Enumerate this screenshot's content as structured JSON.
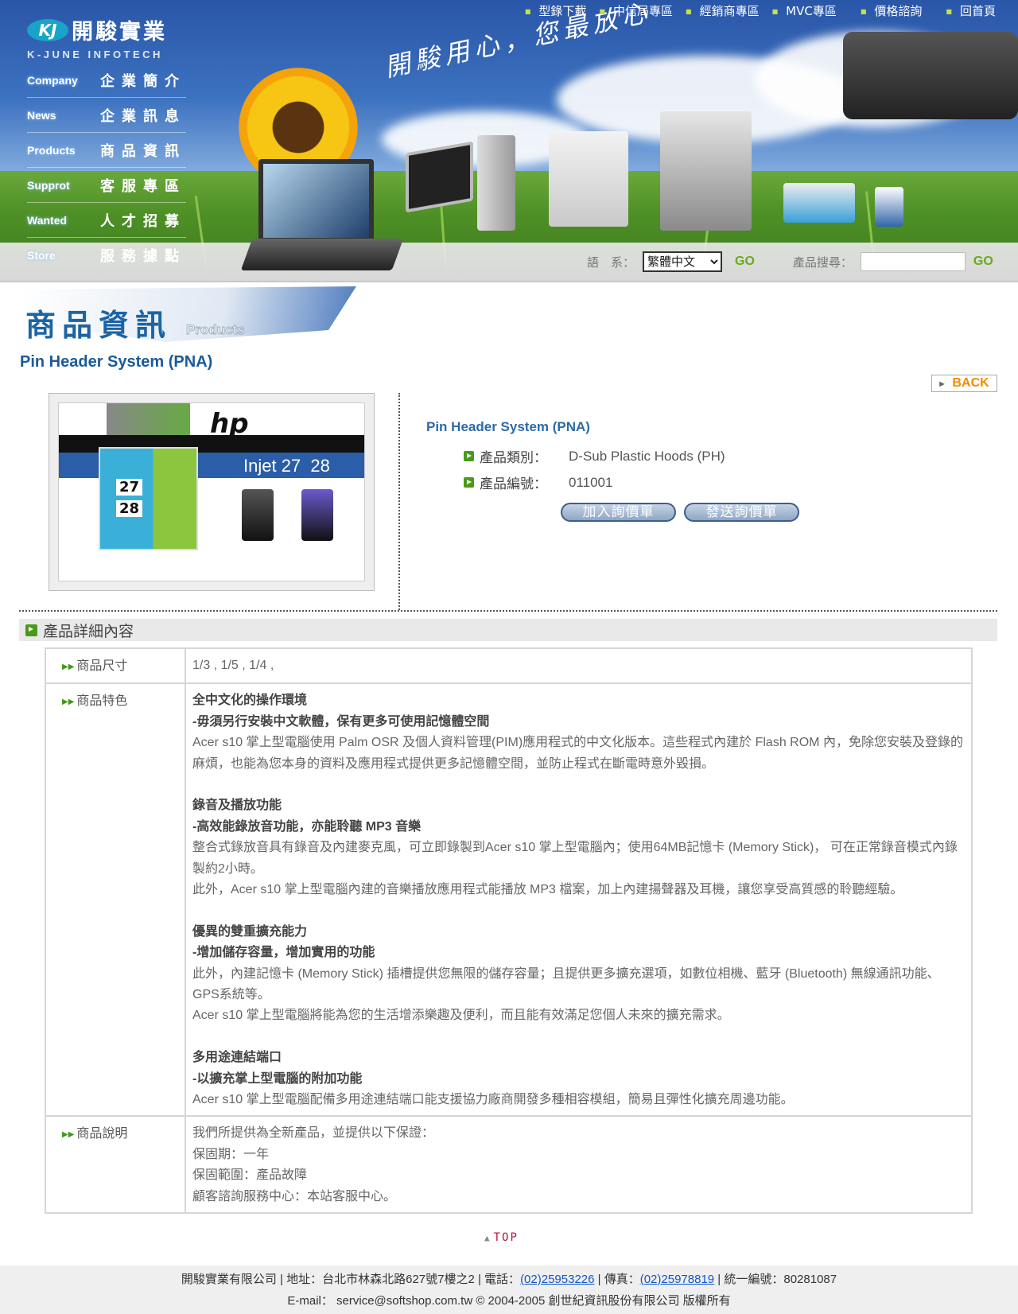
{
  "header": {
    "logo": {
      "mark": "KJ",
      "name_cn": "開駿實業",
      "name_en": "K-JUNE INFOTECH"
    },
    "slogan": "開駿用心，您最放心",
    "top_nav": [
      "型錄下載",
      "中信局專區",
      "經銷商專區",
      "MVC專區",
      "價格諮詢",
      "回首頁"
    ],
    "menu": [
      {
        "en": "Company",
        "cn": "企業簡介"
      },
      {
        "en": "News",
        "cn": "企業訊息"
      },
      {
        "en": "Products",
        "cn": "商品資訊"
      },
      {
        "en": "Supprot",
        "cn": "客服專區"
      },
      {
        "en": "Wanted",
        "cn": "人才招募"
      },
      {
        "en": "Store",
        "cn": "服務據點"
      }
    ],
    "language_label": "語　系：",
    "language_selected": "繁體中文",
    "go_label": "GO",
    "search_label": "產品搜尋：",
    "search_value": "",
    "search_go_label": "GO"
  },
  "section": {
    "title_cn": "商品資訊",
    "title_en": "Products"
  },
  "product": {
    "title": "Pin Header System (PNA)",
    "back_label": "BACK",
    "image_text": {
      "brand": "hp",
      "caption": "Injet 27  28",
      "n1": "27",
      "n2": "28"
    },
    "info_title": "Pin Header System (PNA)",
    "category_label": "產品類別：",
    "category_value": "D-Sub Plastic Hoods (PH)",
    "number_label": "產品編號：",
    "number_value": "011001",
    "add_inquiry_label": "加入詢價單",
    "send_inquiry_label": "發送詢價單"
  },
  "details": {
    "heading": "產品詳細內容",
    "size_label": "商品尺寸",
    "size_value": "1/3 , 1/5 , 1/4 ,",
    "features_label": "商品特色",
    "features": [
      {
        "title": "全中文化的操作環境",
        "subtitle": "-毋須另行安裝中文軟體，保有更多可使用記憶體空間",
        "paragraphs": [
          "Acer s10 掌上型電腦使用 Palm OSR 及個人資料管理(PIM)應用程式的中文化版本。這些程式內建於 Flash ROM 內，免除您安裝及登錄的麻煩，也能為您本身的資料及應用程式提供更多記憶體空間，並防止程式在斷電時意外毀損。"
        ]
      },
      {
        "title": "錄音及播放功能",
        "subtitle": "-高效能錄放音功能，亦能聆聽 MP3 音樂",
        "paragraphs": [
          "整合式錄放音具有錄音及內建麥克風，可立即錄製到Acer s10 掌上型電腦內；使用64MB記憶卡 (Memory Stick)， 可在正常錄音模式內錄製約2小時。",
          "此外，Acer s10 掌上型電腦內建的音樂播放應用程式能播放 MP3 檔案，加上內建揚聲器及耳機，讓您享受高質感的聆聽經驗。"
        ]
      },
      {
        "title": "優異的雙重擴充能力",
        "subtitle": "-增加儲存容量，增加實用的功能",
        "paragraphs": [
          "此外，內建記憶卡 (Memory Stick) 插槽提供您無限的儲存容量；且提供更多擴充選項，如數位相機、藍牙 (Bluetooth) 無線通訊功能、GPS系統等。",
          "Acer s10 掌上型電腦將能為您的生活增添樂趣及便利，而且能有效滿足您個人未來的擴充需求。"
        ]
      },
      {
        "title": "多用途連結端口",
        "subtitle": "-以擴充掌上型電腦的附加功能",
        "paragraphs": [
          "Acer s10 掌上型電腦配備多用途連結端口能支援協力廠商開發多種相容模組，簡易且彈性化擴充周邊功能。"
        ]
      }
    ],
    "description_label": "商品說明",
    "description_lines": [
      "我們所提供為全新產品，並提供以下保證：",
      "保固期：一年",
      "保固範圍：產品故障",
      "顧客諮詢服務中心：本站客服中心。"
    ]
  },
  "top_label": "TOP",
  "footer": {
    "company": "開駿實業有限公司 | 地址：台北市林森北路627號7樓之2 | 電話：",
    "phone": "(02)25953226",
    "fax_label": " | 傳真：",
    "fax": "(02)25978819",
    "tax_id": " | 統一編號：80281087",
    "email_line": "E-mail： service@softshop.com.tw © 2004-2005 創世紀資訊股份有限公司 版權所有"
  },
  "colors": {
    "accent_blue": "#1a5a9a",
    "back_orange": "#f08c00",
    "go_green": "#6aa820",
    "top_red": "#b3163a",
    "icon_green": "#4a9a1a"
  }
}
